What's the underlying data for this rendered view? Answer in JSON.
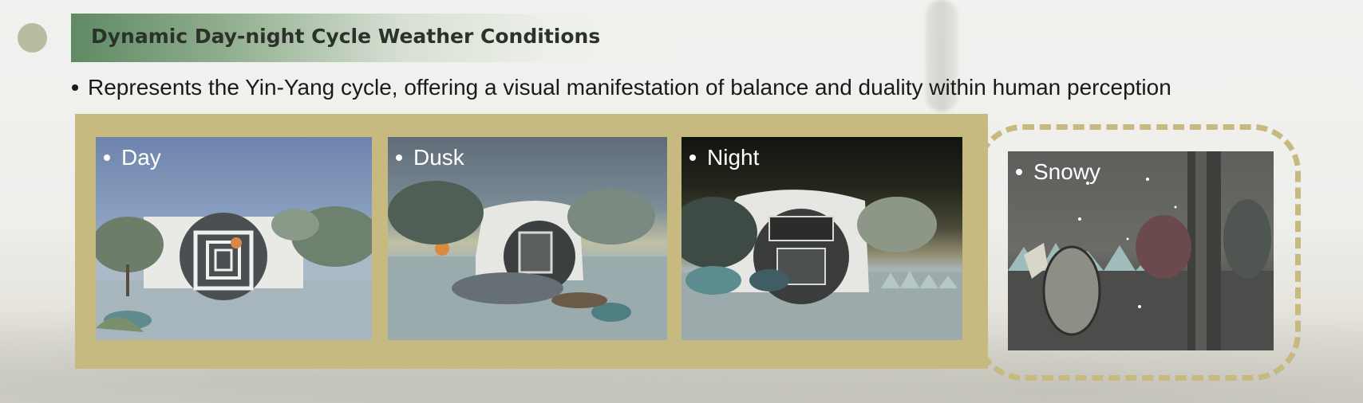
{
  "slide": {
    "title": "Dynamic Day-night Cycle Weather Conditions",
    "bullet": "Represents the Yin-Yang cycle, offering a visual manifestation of balance and duality within human perception"
  },
  "thumbnails": [
    {
      "label": "Day"
    },
    {
      "label": "Dusk"
    },
    {
      "label": "Night"
    },
    {
      "label": "Snowy"
    }
  ],
  "colors": {
    "accent_green": "#5f8a64",
    "panel_gold": "#c7ba80",
    "text_dark": "#1a1a1a"
  }
}
